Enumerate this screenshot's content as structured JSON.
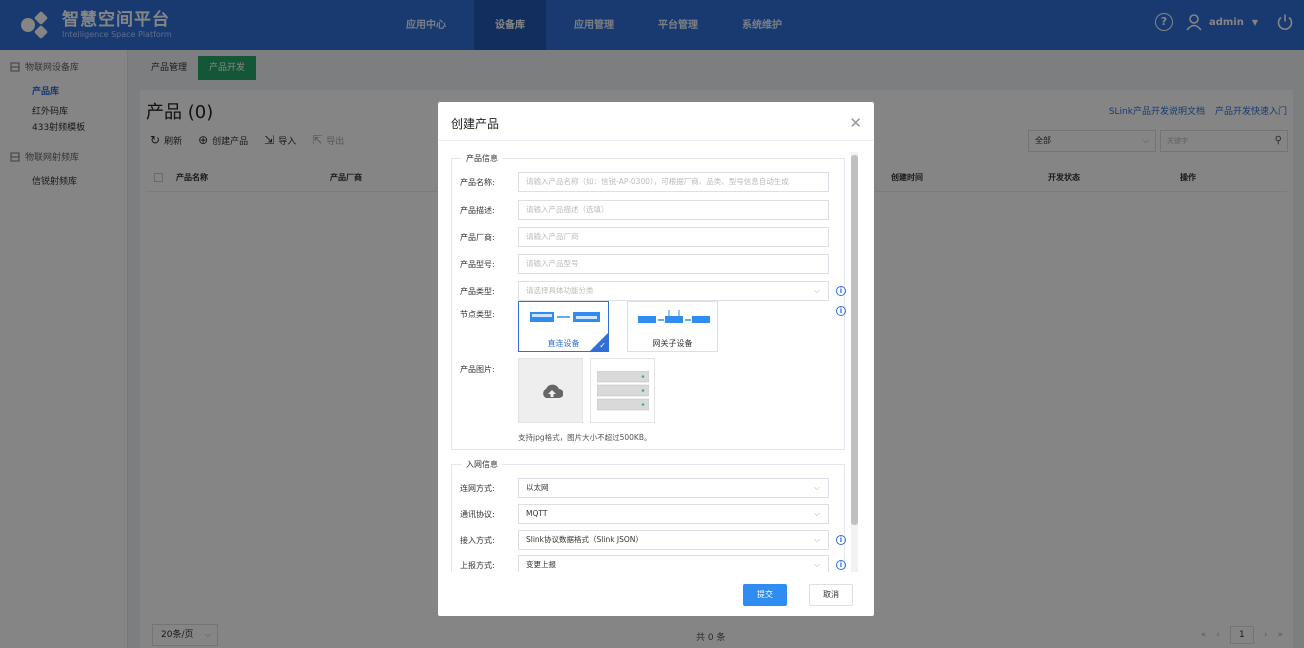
{
  "brand": {
    "title": "智慧空间平台",
    "subtitle": "Intelligence Space Platform"
  },
  "topnav": {
    "items": [
      "应用中心",
      "设备库",
      "应用管理",
      "平台管理",
      "系统维护"
    ],
    "active": "设备库"
  },
  "user": {
    "name": "admin",
    "help_icon": "question-circle-icon",
    "user_icon": "user-icon",
    "power_icon": "power-icon"
  },
  "sidebar": {
    "group1": "物联网设备库",
    "items1": [
      "产品库",
      "红外码库",
      "433射频模板"
    ],
    "group2": "物联网射频库",
    "items2": [
      "信锐射频库"
    ]
  },
  "subtabs": [
    "产品管理",
    "产品开发"
  ],
  "page": {
    "title": "产品 (0)",
    "doc_link1": "SLink产品开发说明文档",
    "doc_link2": "产品开发快速入门"
  },
  "toolbar": {
    "refresh": "刷新",
    "create": "创建产品",
    "import": "导入",
    "export": "导出"
  },
  "filter": {
    "value": "全部",
    "search_placeholder": "关键字"
  },
  "table": {
    "columns": [
      "产品名称",
      "产品厂商",
      "创建时间",
      "开发状态",
      "操作"
    ]
  },
  "footer": {
    "page_size": "20条/页",
    "total": "共 0 条",
    "page": "1"
  },
  "dialog": {
    "title": "创建产品",
    "section1": "产品信息",
    "fields": {
      "name_label": "产品名称:",
      "name_placeholder": "请输入产品名称（如：信锐-AP-0300），可根据厂商、品类、型号信息自动生成",
      "desc_label": "产品描述:",
      "desc_placeholder": "请输入产品描述（选填）",
      "vendor_label": "产品厂商:",
      "vendor_placeholder": "请输入产品厂商",
      "model_label": "产品型号:",
      "model_placeholder": "请输入产品型号",
      "type_label": "产品类型:",
      "type_placeholder": "请选择具体功能分类",
      "node_label": "节点类型:",
      "node_option1": "直连设备",
      "node_option2": "网关子设备",
      "image_label": "产品图片:",
      "image_hint": "支持jpg格式，图片大小不超过500KB。"
    },
    "section2": "入网信息",
    "network": {
      "conn_label": "连网方式:",
      "conn_value": "以太网",
      "proto_label": "通讯协议:",
      "proto_value": "MQTT",
      "access_label": "接入方式:",
      "access_value": "Slink协议数据格式（Slink JSON）",
      "report_label": "上报方式:",
      "report_value": "变更上报"
    },
    "submit": "提交",
    "cancel": "取消"
  },
  "colors": {
    "primary": "#2f6fd6",
    "accent_green": "#26a86a",
    "submit_blue": "#2f8cf0"
  }
}
